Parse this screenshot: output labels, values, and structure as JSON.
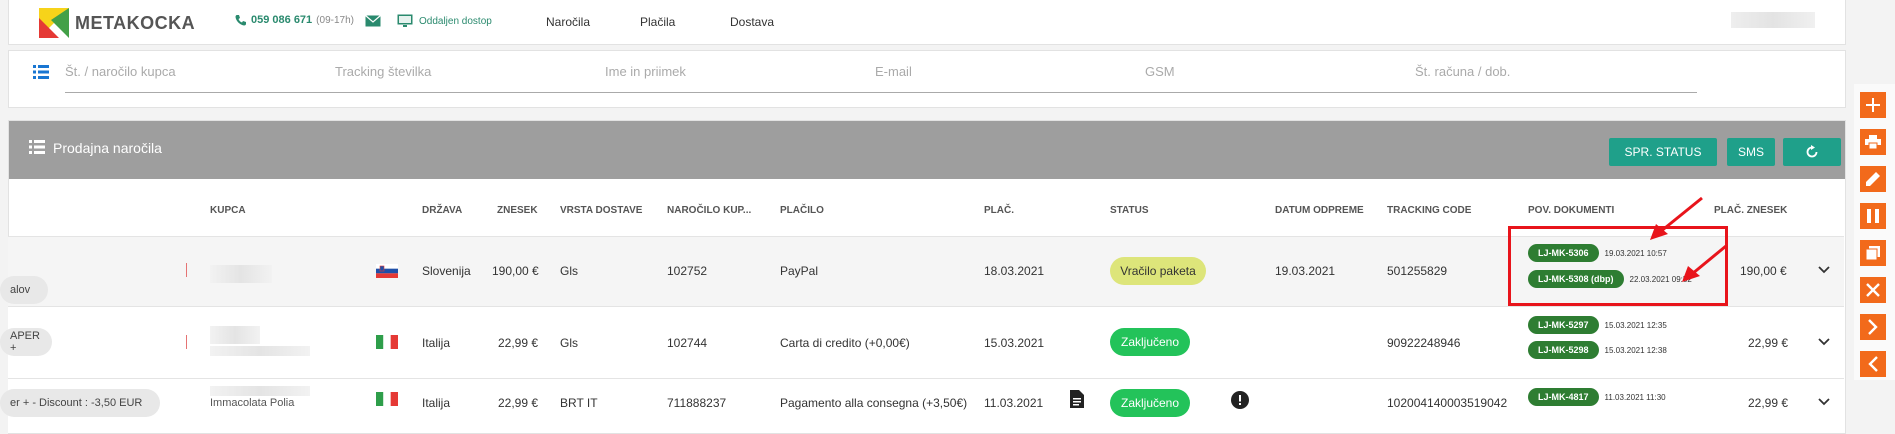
{
  "header": {
    "brand": "METAKOCKA",
    "phone": "059 086 671",
    "phone_hours": "(09-17h)",
    "remote_label": "Oddaljen dostop",
    "nav": [
      "Naročila",
      "Plačila",
      "Dostava"
    ]
  },
  "search": {
    "fields": [
      "Št. / naročilo kupca",
      "Tracking številka",
      "Ime in priimek",
      "E-mail",
      "GSM",
      "Št. računa / dob."
    ]
  },
  "panel": {
    "title": "Prodajna naročila",
    "buttons": [
      "SPR. STATUS",
      "SMS"
    ]
  },
  "columns": [
    "KUPCA",
    "DRŽAVA",
    "ZNESEK",
    "VRSTA DOSTAVE",
    "NAROČILO KUP...",
    "PLAČILO",
    "PLAČ.",
    "STATUS",
    "DATUM ODPREME",
    "TRACKING CODE",
    "POV. DOKUMENTI",
    "PLAČ. ZNESEK"
  ],
  "rows": [
    {
      "tag": "alov",
      "country": "Slovenija",
      "amount": "190,00 €",
      "delivery": "Gls",
      "order_no": "102752",
      "payment": "PayPal",
      "paid_date": "18.03.2021",
      "status": "Vračilo paketa",
      "ship_date": "19.03.2021",
      "tracking": "501255829",
      "docs": [
        {
          "code": "LJ-MK-5306",
          "ts": "19.03.2021 10:57"
        },
        {
          "code": "LJ-MK-5308 (dbp)",
          "ts": "22.03.2021 09:52"
        }
      ],
      "paid_amount": "190,00 €"
    },
    {
      "tag": "APER +",
      "country": "Italija",
      "amount": "22,99 €",
      "delivery": "Gls",
      "order_no": "102744",
      "payment": "Carta di credito (+0,00€)",
      "paid_date": "15.03.2021",
      "status": "Zaključeno",
      "ship_date": "",
      "tracking": "90922248946",
      "docs": [
        {
          "code": "LJ-MK-5297",
          "ts": "15.03.2021 12:35"
        },
        {
          "code": "LJ-MK-5298",
          "ts": "15.03.2021 12:38"
        }
      ],
      "paid_amount": "22,99 €"
    },
    {
      "tag": "er + - Discount : -3,50 EUR",
      "customer_partial": "Immacolata Polia",
      "country": "Italija",
      "amount": "22,99 €",
      "delivery": "BRT IT",
      "order_no": "711888237",
      "payment": "Pagamento alla consegna (+3,50€)",
      "paid_date": "11.03.2021",
      "status": "Zaključeno",
      "ship_date": "",
      "tracking": "102004140003519042",
      "docs": [
        {
          "code": "LJ-MK-4817",
          "ts": "11.03.2021 11:30"
        }
      ],
      "paid_amount": "22,99 €"
    }
  ],
  "colors": {
    "accent": "#1fa08a",
    "status_yellow": "#dde57a",
    "status_green": "#23c35a",
    "doc_green": "#2e7d32",
    "side_orange": "#f26a1b",
    "annotation_red": "#e8141b"
  },
  "side_actions": [
    "plus-icon",
    "print-icon",
    "edit-icon",
    "pause-icon",
    "copy-icon",
    "close-icon",
    "next-icon",
    "prev-icon"
  ]
}
